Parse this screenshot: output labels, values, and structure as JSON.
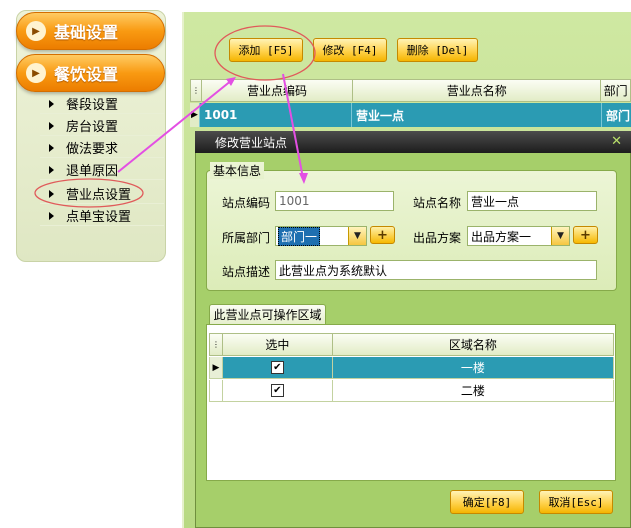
{
  "nav": {
    "categories": [
      {
        "label": "基础设置",
        "icon": "play-circle-icon"
      },
      {
        "label": "餐饮设置",
        "icon": "play-circle-icon"
      }
    ],
    "items": [
      "餐段设置",
      "房台设置",
      "做法要求",
      "退单原因",
      "营业点设置",
      "点单宝设置"
    ]
  },
  "toolbar": {
    "add_label": "添加 [F5]",
    "edit_label": "修改 [F4]",
    "delete_label": "删除 [Del]"
  },
  "grid": {
    "columns": [
      "营业点编码",
      "营业点名称",
      "部门"
    ],
    "rows": [
      {
        "code": "1001",
        "name": "营业一点",
        "dept": "部门"
      }
    ]
  },
  "dialog": {
    "title": "修改营业站点",
    "basic_group": "基本信息",
    "code_label": "站点编码",
    "code_value": "1001",
    "name_label": "站点名称",
    "name_value": "营业一点",
    "dept_label": "所属部门",
    "dept_value": "部门一",
    "plan_label": "出品方案",
    "plan_value": "出品方案一",
    "desc_label": "站点描述",
    "desc_value": "此营业点为系统默认",
    "area_tab": "此营业点可操作区域",
    "area_columns": [
      "选中",
      "区域名称"
    ],
    "areas": [
      {
        "checked": true,
        "name": "一楼"
      },
      {
        "checked": true,
        "name": "二楼"
      }
    ],
    "ok_label": "确定[F8]",
    "cancel_label": "取消[Esc]"
  },
  "colors": {
    "accent_orange": "#f99a12",
    "selection": "#2b9bb3",
    "panel_green": "#a6cf6a",
    "annotation": "#e34fe3"
  }
}
